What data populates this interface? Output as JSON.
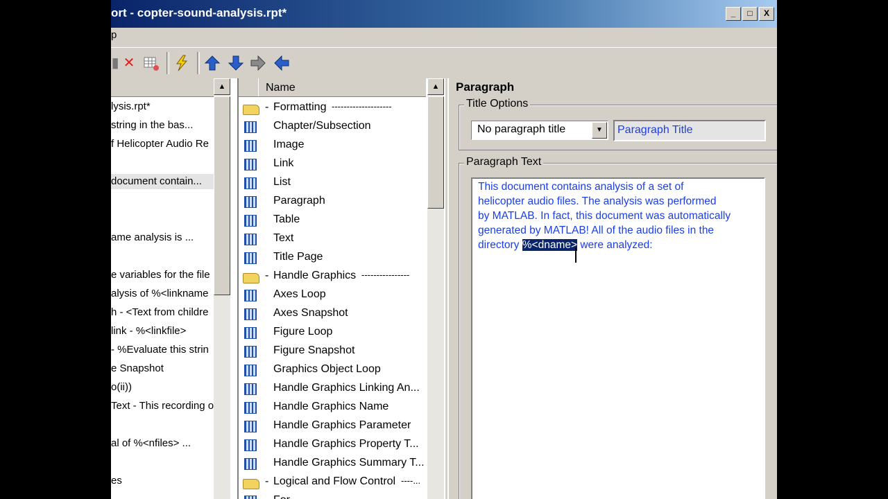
{
  "window": {
    "title": "ort - copter-sound-analysis.rpt*",
    "min": "_",
    "max": "□",
    "close": "X"
  },
  "menubar": {
    "item": "p"
  },
  "toolbar": {
    "icons": [
      "page-icon",
      "delete-icon",
      "table-icon",
      "lightning-icon",
      "move-up-icon",
      "move-down-icon",
      "move-right-icon",
      "move-left-icon"
    ]
  },
  "left_tree": {
    "items": [
      {
        "label": "lysis.rpt*",
        "selected": false
      },
      {
        "label": "string in the bas...",
        "selected": false
      },
      {
        "label": "f Helicopter Audio Re",
        "selected": false
      },
      {
        "label": "",
        "selected": false
      },
      {
        "label": "document contain...",
        "selected": true
      },
      {
        "label": "",
        "selected": false
      },
      {
        "label": "",
        "selected": false
      },
      {
        "label": "ame analysis is ...",
        "selected": false
      },
      {
        "label": "",
        "selected": false
      },
      {
        "label": "e variables for the file",
        "selected": false
      },
      {
        "label": "alysis of %<linkname",
        "selected": false
      },
      {
        "label": "h - <Text from childre",
        "selected": false
      },
      {
        "label": "link - %<linkfile>",
        "selected": false
      },
      {
        "label": "- %Evaluate this strin",
        "selected": false
      },
      {
        "label": "e Snapshot",
        "selected": false
      },
      {
        "label": "o(ii))",
        "selected": false
      },
      {
        "label": "Text - This recording o",
        "selected": false
      },
      {
        "label": "",
        "selected": false
      },
      {
        "label": "al of %<nfiles> ...",
        "selected": false
      },
      {
        "label": "",
        "selected": false
      },
      {
        "label": "es",
        "selected": false
      }
    ]
  },
  "components": {
    "header": "Name",
    "rows": [
      {
        "type": "folder",
        "label": "Formatting",
        "dashes": "--------------------"
      },
      {
        "type": "item",
        "label": "Chapter/Subsection"
      },
      {
        "type": "item",
        "label": "Image"
      },
      {
        "type": "item",
        "label": "Link"
      },
      {
        "type": "item",
        "label": "List"
      },
      {
        "type": "item",
        "label": "Paragraph"
      },
      {
        "type": "item",
        "label": "Table"
      },
      {
        "type": "item",
        "label": "Text"
      },
      {
        "type": "item",
        "label": "Title Page"
      },
      {
        "type": "folder",
        "label": "Handle Graphics",
        "dashes": "----------------"
      },
      {
        "type": "item",
        "label": "Axes Loop"
      },
      {
        "type": "item",
        "label": "Axes Snapshot"
      },
      {
        "type": "item",
        "label": "Figure Loop"
      },
      {
        "type": "item",
        "label": "Figure Snapshot"
      },
      {
        "type": "item",
        "label": "Graphics Object Loop"
      },
      {
        "type": "item",
        "label": "Handle Graphics Linking An..."
      },
      {
        "type": "item",
        "label": "Handle Graphics Name"
      },
      {
        "type": "item",
        "label": "Handle Graphics Parameter"
      },
      {
        "type": "item",
        "label": "Handle Graphics Property T..."
      },
      {
        "type": "item",
        "label": "Handle Graphics Summary T..."
      },
      {
        "type": "folder",
        "label": "Logical and Flow Control",
        "dashes": "----..."
      },
      {
        "type": "item",
        "label": "For"
      }
    ]
  },
  "properties": {
    "title": "Paragraph",
    "title_options_label": "Title Options",
    "title_mode": "No paragraph title",
    "paragraph_title": "Paragraph Title",
    "paragraph_text_label": "Paragraph Text",
    "text_lines": [
      "This document contains analysis of a set of",
      "helicopter audio files.  The analysis was performed",
      "by MATLAB.  In fact, this document was automatically",
      "generated by MATLAB!  All of the audio files in the"
    ],
    "last_line_pre": "directory ",
    "last_line_sel": "%<dname>",
    "last_line_post": " were analyzed:"
  },
  "colors": {
    "text_blue": "#1a3ee8",
    "selection": "#0a246a",
    "chrome": "#d4d0c8"
  }
}
